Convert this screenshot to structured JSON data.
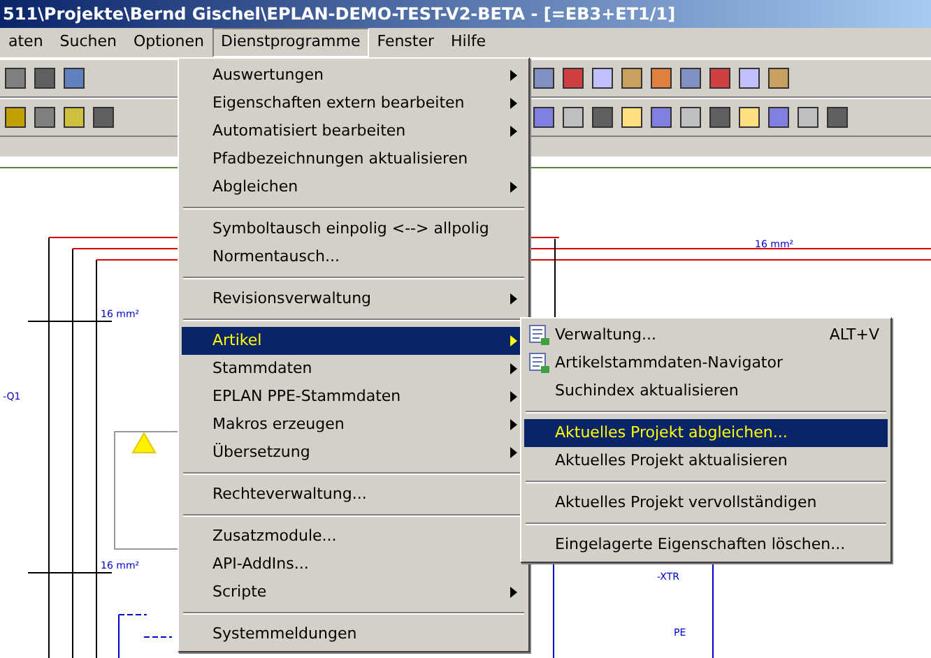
{
  "window": {
    "title": "511\\Projekte\\Bernd Gischel\\EPLAN-DEMO-TEST-V2-BETA - [=EB3+ET1/1]"
  },
  "menu_bar": [
    {
      "label": "aten",
      "selected": false
    },
    {
      "label": "Suchen",
      "selected": false
    },
    {
      "label": "Optionen",
      "selected": false
    },
    {
      "label": "Dienstprogramme",
      "selected": true
    },
    {
      "label": "Fenster",
      "selected": false
    },
    {
      "label": "Hilfe",
      "selected": false
    }
  ],
  "menu": [
    {
      "kind": "item",
      "label": "Auswertungen",
      "submenu": true,
      "selected": false
    },
    {
      "kind": "item",
      "label": "Eigenschaften extern bearbeiten",
      "submenu": true,
      "selected": false
    },
    {
      "kind": "item",
      "label": "Automatisiert bearbeiten",
      "submenu": true,
      "selected": false
    },
    {
      "kind": "item",
      "label": "Pfadbezeichnungen aktualisieren",
      "submenu": false,
      "selected": false
    },
    {
      "kind": "item",
      "label": "Abgleichen",
      "submenu": true,
      "selected": false
    },
    {
      "kind": "separator"
    },
    {
      "kind": "item",
      "label": "Symboltausch einpolig <--> allpolig",
      "submenu": false,
      "selected": false
    },
    {
      "kind": "item",
      "label": "Normentausch...",
      "submenu": false,
      "selected": false
    },
    {
      "kind": "separator"
    },
    {
      "kind": "item",
      "label": "Revisionsverwaltung",
      "submenu": true,
      "selected": false
    },
    {
      "kind": "separator"
    },
    {
      "kind": "item",
      "label": "Artikel",
      "submenu": true,
      "selected": true
    },
    {
      "kind": "item",
      "label": "Stammdaten",
      "submenu": true,
      "selected": false
    },
    {
      "kind": "item",
      "label": "EPLAN PPE-Stammdaten",
      "submenu": true,
      "selected": false
    },
    {
      "kind": "item",
      "label": "Makros erzeugen",
      "submenu": true,
      "selected": false
    },
    {
      "kind": "item",
      "label": "Übersetzung",
      "submenu": true,
      "selected": false
    },
    {
      "kind": "separator"
    },
    {
      "kind": "item",
      "label": "Rechteverwaltung...",
      "submenu": false,
      "selected": false
    },
    {
      "kind": "separator"
    },
    {
      "kind": "item",
      "label": "Zusatzmodule...",
      "submenu": false,
      "selected": false
    },
    {
      "kind": "item",
      "label": "API-AddIns...",
      "submenu": false,
      "selected": false
    },
    {
      "kind": "item",
      "label": "Scripte",
      "submenu": true,
      "selected": false
    },
    {
      "kind": "separator"
    },
    {
      "kind": "item",
      "label": "Systemmeldungen",
      "submenu": false,
      "selected": false
    }
  ],
  "submenu": [
    {
      "kind": "item",
      "label": "Verwaltung...",
      "icon": true,
      "shortcut": "ALT+V",
      "selected": false
    },
    {
      "kind": "item",
      "label": "Artikelstammdaten-Navigator",
      "icon": true,
      "selected": false
    },
    {
      "kind": "item",
      "label": "Suchindex aktualisieren",
      "icon": false,
      "selected": false
    },
    {
      "kind": "separator"
    },
    {
      "kind": "item",
      "label": "Aktuelles Projekt abgleichen...",
      "icon": false,
      "selected": true
    },
    {
      "kind": "item",
      "label": "Aktuelles Projekt aktualisieren",
      "icon": false,
      "selected": false
    },
    {
      "kind": "separator"
    },
    {
      "kind": "item",
      "label": "Aktuelles Projekt vervollständigen",
      "icon": false,
      "selected": false
    },
    {
      "kind": "separator"
    },
    {
      "kind": "item",
      "label": "Eingelagerte Eigenschaften löschen...",
      "icon": false,
      "selected": false
    }
  ],
  "schematic": {
    "labels": [
      "16 mm²",
      "16 mm²",
      "16 mm²",
      "-Q1",
      "-XTR",
      "PE"
    ]
  }
}
